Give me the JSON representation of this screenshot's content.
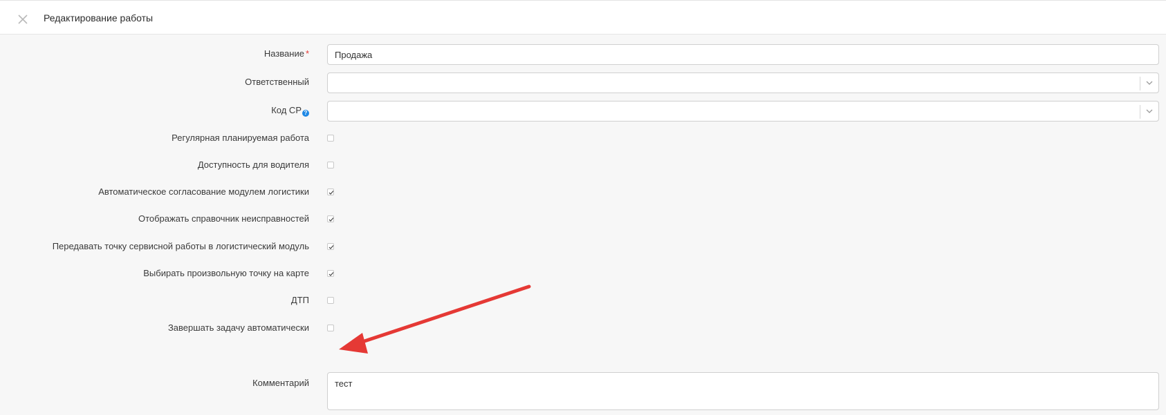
{
  "header": {
    "title": "Редактирование работы",
    "close_icon": "close-icon"
  },
  "form": {
    "name": {
      "label": "Название",
      "required_mark": "*",
      "value": "Продажа"
    },
    "responsible": {
      "label": "Ответственный",
      "value": ""
    },
    "cr_code": {
      "label": "Код СР",
      "help_icon": "question-icon",
      "help_glyph": "?",
      "value": ""
    },
    "checkboxes": [
      {
        "label": "Регулярная планируемая работа",
        "checked": false
      },
      {
        "label": "Доступность для водителя",
        "checked": false
      },
      {
        "label": "Автоматическое согласование модулем логистики",
        "checked": true
      },
      {
        "label": "Отображать справочник неисправностей",
        "checked": true
      },
      {
        "label": "Передавать точку сервисной работы в логистический модуль",
        "checked": true
      },
      {
        "label": "Выбирать произвольную точку на карте",
        "checked": true
      },
      {
        "label": "ДТП",
        "checked": false
      },
      {
        "label": "Завершать задачу автоматически",
        "checked": false
      }
    ],
    "comment": {
      "label": "Комментарий",
      "value": "тест"
    }
  },
  "annotation": {
    "type": "arrow",
    "color": "#e53935",
    "points_to": "Завершать задачу автоматически"
  }
}
